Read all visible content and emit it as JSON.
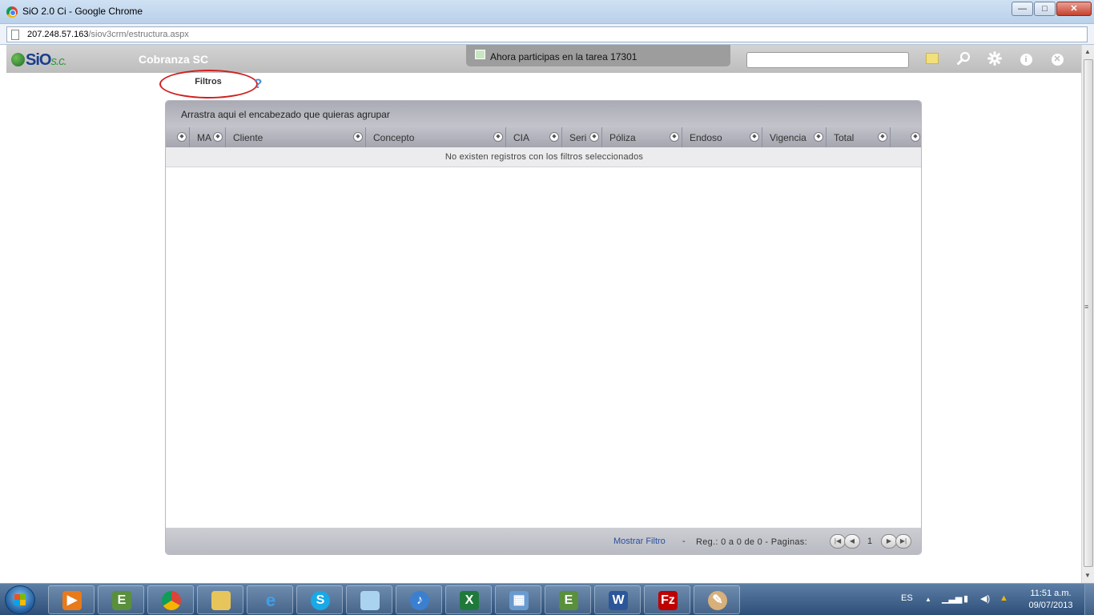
{
  "window": {
    "title": "SiO 2.0 Ci - Google Chrome",
    "minimize": "—",
    "maximize": "□",
    "close": "✕"
  },
  "browser": {
    "url_host": "207.248.57.163",
    "url_path": "/siov3crm/estructura.aspx"
  },
  "app": {
    "logo_main": "SiO",
    "logo_suffix": "s.c.",
    "title": "Cobranza SC",
    "notice": "Ahora participas en la tarea 17301",
    "search_value": "",
    "icons": [
      "note-icon",
      "search-icon",
      "gear-icon",
      "info-icon",
      "close-icon"
    ]
  },
  "toolbar": {
    "filters_label": "Filtros",
    "help_glyph": "?"
  },
  "grid": {
    "group_hint": "Arrastra aqui el encabezado que quieras agrupar",
    "columns": [
      "",
      "MA",
      "Cliente",
      "Concepto",
      "CIA",
      "Seri",
      "Póliza",
      "Endoso",
      "Vigencia",
      "Total",
      ""
    ],
    "empty_message": "No existen registros con los filtros seleccionados",
    "rows": []
  },
  "pager": {
    "show_filter": "Mostrar Filtro",
    "separator": "-",
    "summary": "Reg.: 0 a 0 de 0 - Paginas:",
    "current_page": "1"
  },
  "taskbar": {
    "apps": [
      "media-player",
      "evernote",
      "chrome",
      "explorer",
      "internet-explorer",
      "skype",
      "notepad",
      "itunes",
      "excel",
      "control-panel",
      "evernote",
      "word",
      "filezilla",
      "paint"
    ],
    "language": "ES",
    "time": "11:51 a.m.",
    "date": "09/07/2013"
  }
}
